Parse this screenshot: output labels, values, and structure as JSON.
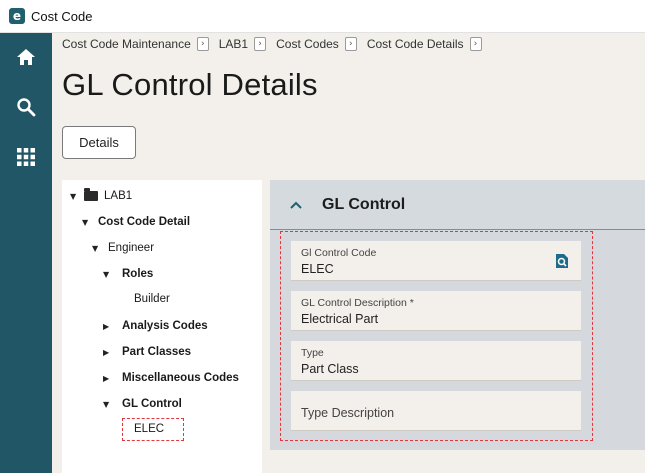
{
  "window": {
    "title": "Cost Code",
    "logo_letter": "e"
  },
  "nav": {
    "icons": [
      "home-icon",
      "search-icon",
      "apps-grid-icon"
    ]
  },
  "breadcrumb": [
    "Cost Code Maintenance",
    "LAB1",
    "Cost Codes",
    "Cost Code Details"
  ],
  "breadcrumb_arrow": "›",
  "page": {
    "title": "GL Control Details",
    "details_button": "Details"
  },
  "tree": [
    {
      "label": "LAB1",
      "toggle": "▼",
      "folder": true,
      "bold": false
    },
    {
      "label": "Cost Code Detail",
      "toggle": "▼",
      "bold": true
    },
    {
      "label": "Engineer",
      "toggle": "▼",
      "bold": false
    },
    {
      "label": "Roles",
      "toggle": "▼",
      "bold": true
    },
    {
      "label": "Builder",
      "toggle": "",
      "bold": false
    },
    {
      "label": "Analysis Codes",
      "toggle": "▶",
      "bold": true
    },
    {
      "label": "Part Classes",
      "toggle": "▶",
      "bold": true
    },
    {
      "label": "Miscellaneous Codes",
      "toggle": "▶",
      "bold": true
    },
    {
      "label": "GL Control",
      "toggle": "▼",
      "bold": true
    },
    {
      "label": "ELEC",
      "toggle": "",
      "bold": false,
      "selected": true
    }
  ],
  "section": {
    "title": "GL Control"
  },
  "fields": {
    "gl_control_code": {
      "label": "Gl Control Code",
      "value": "ELEC"
    },
    "gl_control_description": {
      "label": "GL Control Description *",
      "value": "Electrical Part"
    },
    "type": {
      "label": "Type",
      "value": "Part Class"
    },
    "type_description": {
      "label": "Type Description",
      "value": ""
    }
  },
  "colors": {
    "nav_bg": "#205666",
    "accent_teal": "#5b9da8",
    "highlight_red": "#e0383e",
    "lookup_icon": "#1f6b8a"
  }
}
